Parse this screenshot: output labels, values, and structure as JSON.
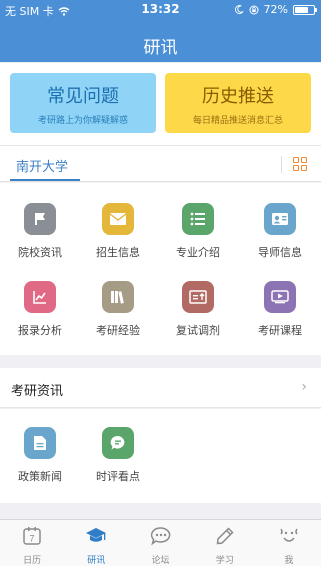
{
  "status_bar": {
    "carrier": "无 SIM 卡",
    "time": "13:32",
    "battery": "72%",
    "battery_level": 0.72
  },
  "nav": {
    "title": "研讯"
  },
  "cards": [
    {
      "title": "常见问题",
      "subtitle": "考研路上为你解疑解惑"
    },
    {
      "title": "历史推送",
      "subtitle": "每日精品推送消息汇总"
    }
  ],
  "school": {
    "name": "南开大学"
  },
  "menu": [
    {
      "label": "院校资讯",
      "icon": "flag-icon",
      "color": "#8a8f96"
    },
    {
      "label": "招生信息",
      "icon": "envelope-icon",
      "color": "#e4b73a"
    },
    {
      "label": "专业介绍",
      "icon": "list-icon",
      "color": "#5aa66a"
    },
    {
      "label": "导师信息",
      "icon": "id-card-icon",
      "color": "#6aa6cc"
    },
    {
      "label": "报录分析",
      "icon": "chart-icon",
      "color": "#e06a86"
    },
    {
      "label": "考研经验",
      "icon": "books-icon",
      "color": "#a69b84"
    },
    {
      "label": "复试调剂",
      "icon": "ticket-icon",
      "color": "#b26b64"
    },
    {
      "label": "考研课程",
      "icon": "video-icon",
      "color": "#8c74b4"
    }
  ],
  "news": {
    "title": "考研资讯",
    "items": [
      {
        "label": "政策新闻",
        "icon": "document-icon",
        "color": "#6aa6cc"
      },
      {
        "label": "时评看点",
        "icon": "comment-icon",
        "color": "#5aa66a"
      }
    ]
  },
  "tabs": [
    {
      "label": "日历",
      "icon": "calendar-icon",
      "day": "7"
    },
    {
      "label": "研讯",
      "icon": "graduation-cap-icon"
    },
    {
      "label": "论坛",
      "icon": "chat-icon"
    },
    {
      "label": "学习",
      "icon": "pencil-icon"
    },
    {
      "label": "我",
      "icon": "face-icon"
    }
  ]
}
